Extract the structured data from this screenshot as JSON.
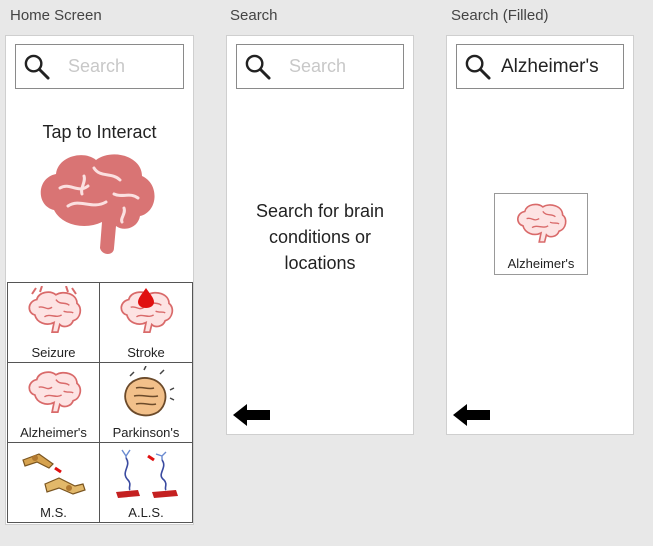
{
  "screens": {
    "home": {
      "title": "Home Screen",
      "search_placeholder": "Search",
      "tap_label": "Tap to Interact",
      "tiles": [
        {
          "label": "Seizure",
          "icon": "brain-seizure-icon"
        },
        {
          "label": "Stroke",
          "icon": "brain-stroke-icon"
        },
        {
          "label": "Alzheimer's",
          "icon": "brain-icon"
        },
        {
          "label": "Parkinson's",
          "icon": "trembling-hands-icon"
        },
        {
          "label": "M.S.",
          "icon": "damaged-neuron-icon"
        },
        {
          "label": "A.L.S.",
          "icon": "motor-neuron-icon"
        }
      ]
    },
    "search": {
      "title": "Search",
      "search_placeholder": "Search",
      "hint": "Search for brain conditions or locations"
    },
    "search_filled": {
      "title": "Search (Filled)",
      "search_value": "Alzheimer's",
      "result_label": "Alzheimer's"
    }
  },
  "colors": {
    "brain_fill": "#d97474",
    "brain_light": "#fadcdc",
    "stroke_red": "#e01010",
    "background": "#e8e8e8"
  }
}
